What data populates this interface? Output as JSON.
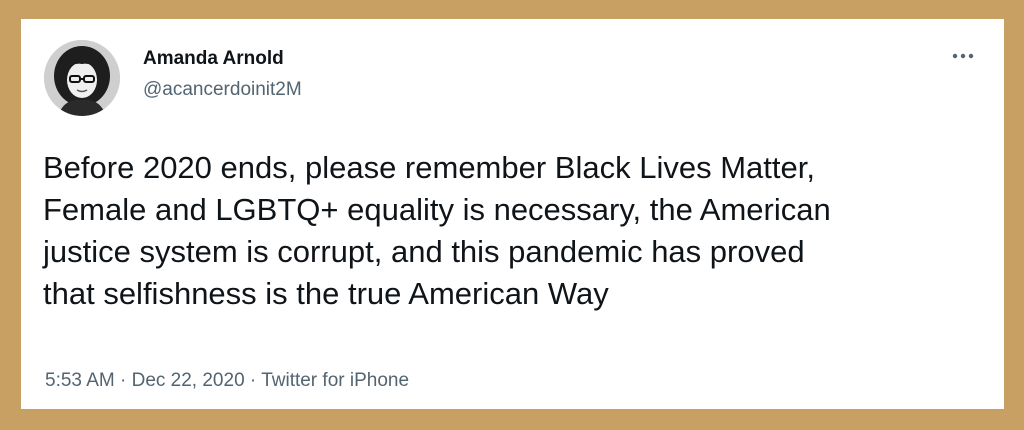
{
  "author": {
    "name": "Amanda Arnold",
    "handle": "@acancerdoinit2M"
  },
  "tweet": {
    "lines": [
      "Before 2020 ends, please remember Black Lives Matter,",
      "Female and LGBTQ+ equality is necessary, the American",
      "justice system is corrupt, and this pandemic has proved",
      "that selfishness is the true American Way"
    ]
  },
  "meta": {
    "time": "5:53 AM",
    "separator": "·",
    "date": "Dec 22, 2020",
    "source": "Twitter for iPhone"
  },
  "icons": {
    "more": "more-icon"
  },
  "colors": {
    "frame": "#c9a063",
    "card": "#ffffff",
    "text": "#0f1419",
    "secondary": "#536471"
  }
}
